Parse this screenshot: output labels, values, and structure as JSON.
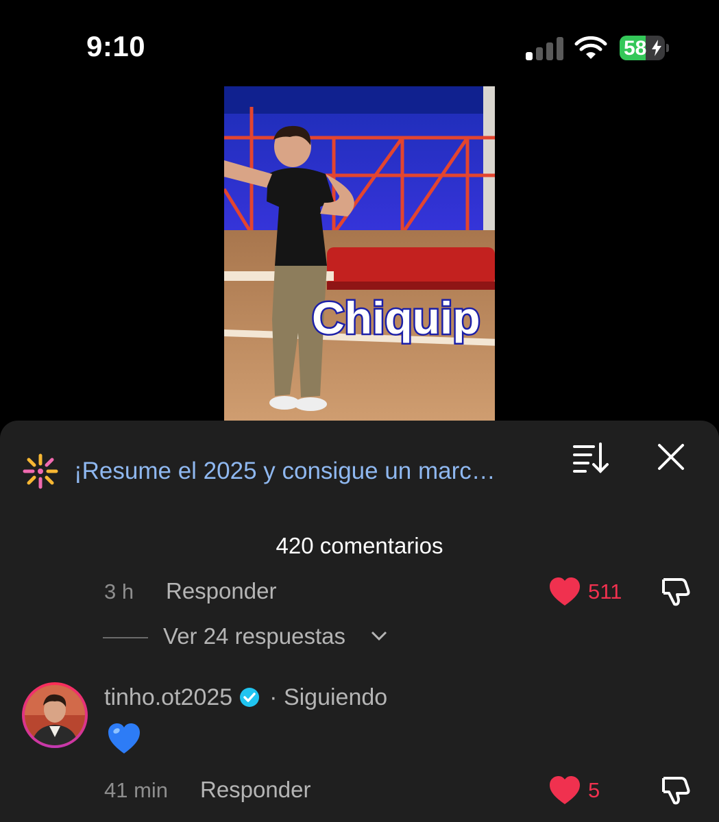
{
  "status_bar": {
    "time": "9:10",
    "battery": "58",
    "battery_level": 0.58
  },
  "video": {
    "caption": "Chiquip"
  },
  "sheet": {
    "promo_text": "¡Resume el 2025 y consigue un marc…",
    "comment_count": "420 comentarios"
  },
  "previous_comment": {
    "time": "3 h",
    "reply_label": "Responder",
    "likes": "511",
    "view_replies": "Ver 24 respuestas"
  },
  "comment": {
    "username": "tinho.ot2025",
    "following_label": "· Siguiendo",
    "text": "💙",
    "time": "41 min",
    "reply_label": "Responder",
    "likes": "5"
  },
  "colors": {
    "like": "#f0314f",
    "link": "#8fb8f0",
    "verified": "#20c4f0",
    "sheet_bg": "#1f1f1f"
  },
  "icons": [
    "signal-icon",
    "wifi-icon",
    "battery-icon",
    "sparkle-icon",
    "sort-icon",
    "close-icon",
    "heart-icon",
    "dislike-icon",
    "chevron-down-icon",
    "verified-icon",
    "blue-heart-emoji"
  ]
}
